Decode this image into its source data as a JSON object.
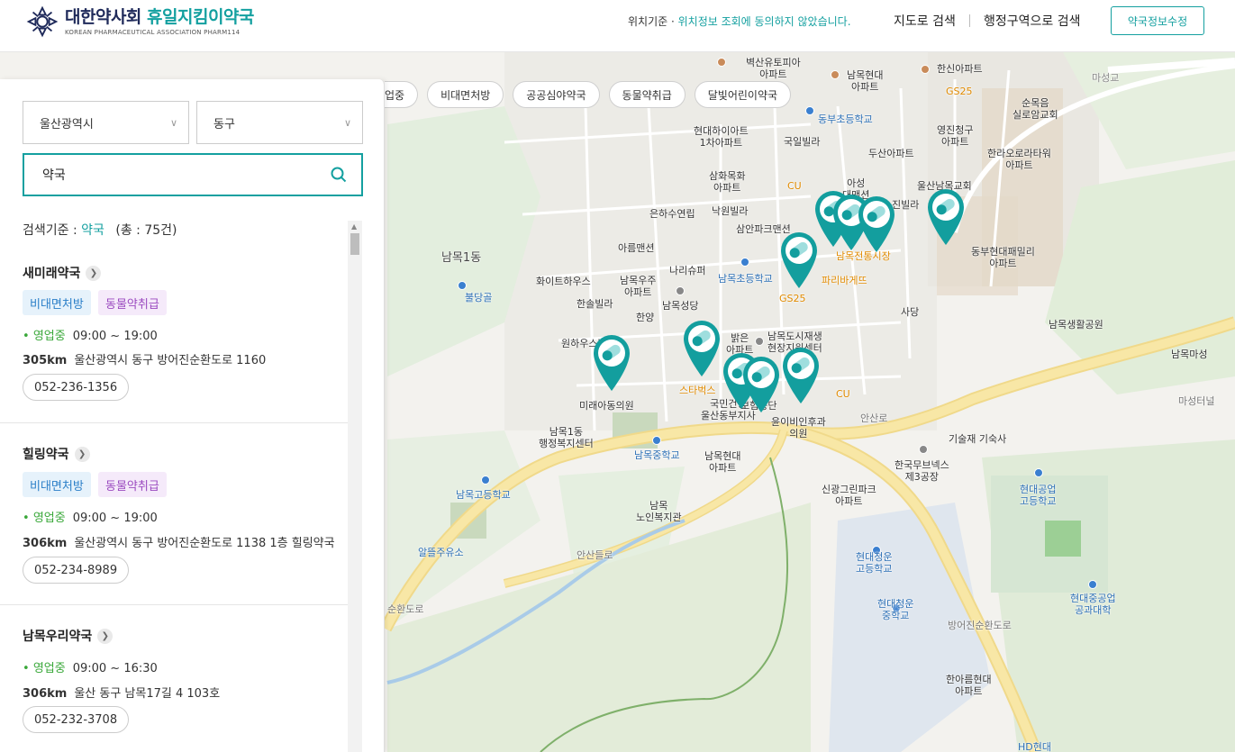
{
  "header": {
    "logo_main_1": "대한약사회",
    "logo_main_2": "휴일지킴이약국",
    "logo_sub": "KOREAN PHARMACEUTICAL ASSOCIATION PHARM114",
    "location_prefix": "위치기준 · ",
    "location_link": "위치정보 조회에 동의하지 않았습니다.",
    "nav_map_search": "지도로 검색",
    "nav_region_search": "행정구역으로 검색",
    "edit_button": "약국정보수정"
  },
  "filters": {
    "chips": [
      "업중",
      "비대면처방",
      "공공심야약국",
      "동물약취급",
      "달빛어린이약국"
    ]
  },
  "panel": {
    "city_select": "울산광역시",
    "district_select": "동구",
    "search_value": "약국",
    "criteria_label": "검색기준 : ",
    "criteria_keyword": "약국",
    "criteria_count": "(총 : 75건)",
    "items": [
      {
        "name": "새미래약국",
        "tags": [
          "비대면처방",
          "동물약취급"
        ],
        "status": "영업중",
        "hours": "09:00 ~ 19:00",
        "distance": "305km",
        "address": "울산광역시 동구 방어진순환도로 1160",
        "phone": "052-236-1356"
      },
      {
        "name": "힐링약국",
        "tags": [
          "비대면처방",
          "동물약취급"
        ],
        "status": "영업중",
        "hours": "09:00 ~ 19:00",
        "distance": "306km",
        "address": "울산광역시 동구 방어진순환도로 1138 1층 힐링약국",
        "phone": "052-234-8989"
      },
      {
        "name": "남목우리약국",
        "tags": [],
        "status": "영업중",
        "hours": "09:00 ~ 16:30",
        "distance": "306km",
        "address": "울산 동구 남목17길 4 103호",
        "phone": "052-232-3708"
      }
    ]
  },
  "map": {
    "labels": {
      "l1": "벽산유토피아\n아파트",
      "l2": "남목현대\n아파트",
      "l3": "한신아파트",
      "l4": "GS25",
      "l5": "마성교",
      "l6": "순목음\n실로암교회",
      "l7": "동부초등학교",
      "l8": "현대하이아트\n1차아파트",
      "l9": "국일빌라",
      "l10": "영진청구\n아파트",
      "l11": "한라오로라타워\n아파트",
      "l12": "두산아파트",
      "l13": "삼화목화\n아파트",
      "l14": "CU",
      "l15": "아성\n대맨션",
      "l16": "울산남목교회",
      "l17": "은하수연립",
      "l18": "낙원빌라",
      "l19": "삼안파크맨션",
      "l20": "진빌라",
      "l21": "남목1동",
      "l22": "아름맨션",
      "l23": "동부현대패밀리\n아파트",
      "l24": "화이트하우스",
      "l25": "나리슈퍼",
      "l26": "남목초등학교",
      "l27": "남목전통시장",
      "l28": "불당골",
      "l29": "남목우주\n아파트",
      "l30": "파리바게뜨",
      "l31": "GS25",
      "l32": "한솔빌라",
      "l33": "남목성당",
      "l34": "사당",
      "l35": "한양",
      "l36": "남목생활공원",
      "l37": "원하우스빌라",
      "l38": "밝은\n아파트",
      "l39": "남목도시재생\n현장지원센터",
      "l40": "남목마성",
      "l41": "스타벅스",
      "l42": "CU",
      "l43": "마성터널",
      "l44": "미래아동의원",
      "l45": "국민건강\n울산동부지사",
      "l46": "보험공단",
      "l47": "안산로",
      "l48": "윤이비인후과\n의원",
      "l49": "남목1동\n행정복지센터",
      "l50": "기술재 기숙사",
      "l51": "남목중학교",
      "l52": "남목현대\n아파트",
      "l53": "한국무브넥스\n제3공장",
      "l54": "남목고등학교",
      "l55": "신광그린파크\n아파트",
      "l56": "현대공업\n고등학교",
      "l57": "남목\n노인복지관",
      "l58": "알뜰주유소",
      "l59": "안산들로",
      "l60": "현대청운\n고등학교",
      "l61": "현대중공업\n공과대학",
      "l62": "현대청운\n중학교",
      "l63": "순환도로",
      "l64": "방어진순환도로",
      "l65": "한아름현대\n아파트",
      "l66": "HD현대"
    }
  },
  "colors": {
    "accent": "#14a0a0",
    "pin": "#139e9e",
    "open_green": "#3aa83a"
  }
}
